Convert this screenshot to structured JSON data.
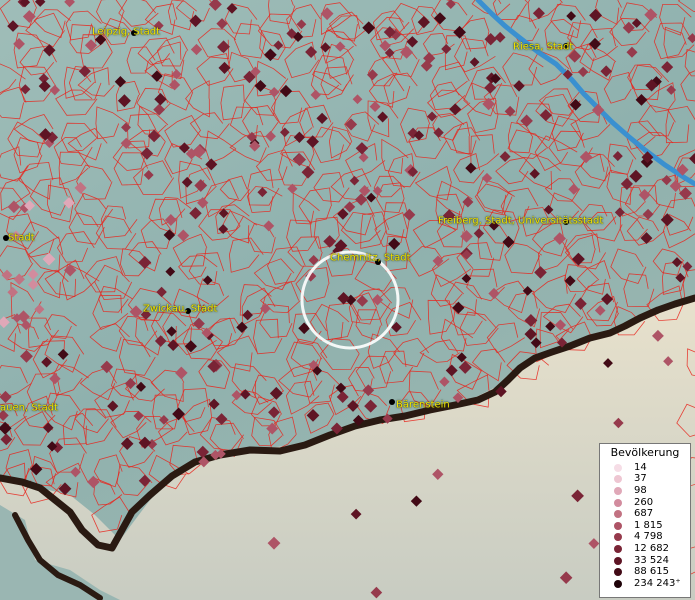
{
  "cities": [
    {
      "name": "Leipzig, Stadt"
    },
    {
      "name": "Riesa, Stadt"
    },
    {
      "name": "Freiberg, Stadt, Universitätsstadt"
    },
    {
      "name": "Chemnitz, Stadt"
    },
    {
      "name": "Zwickau, Stadt"
    },
    {
      "name": "Stadt"
    },
    {
      "name": "auen, Stadt"
    },
    {
      "name": "Bärenstein"
    }
  ],
  "legend": {
    "title": "Bevölkerung",
    "items": [
      {
        "label": "14",
        "color": "#f6dde6"
      },
      {
        "label": "37",
        "color": "#eec6d2"
      },
      {
        "label": "98",
        "color": "#e0a8b8"
      },
      {
        "label": "260",
        "color": "#d28c9e"
      },
      {
        "label": "687",
        "color": "#c27282"
      },
      {
        "label": "1 815",
        "color": "#ae5466"
      },
      {
        "label": "4 798",
        "color": "#963a4c"
      },
      {
        "label": "12 682",
        "color": "#7a2436"
      },
      {
        "label": "33 524",
        "color": "#5e1424"
      },
      {
        "label": "88 615",
        "color": "#420a16"
      },
      {
        "label": "234 243⁺",
        "color": "#1e0208"
      }
    ]
  },
  "colors": {
    "terrain": "#8fb1ae",
    "mountains": "#d9d3bf",
    "border": "#2a1a12",
    "boundary_lines": "#e8251c",
    "river": "#3a90d0",
    "label": "#f2e600",
    "highlight_ring": "#ffffff"
  }
}
